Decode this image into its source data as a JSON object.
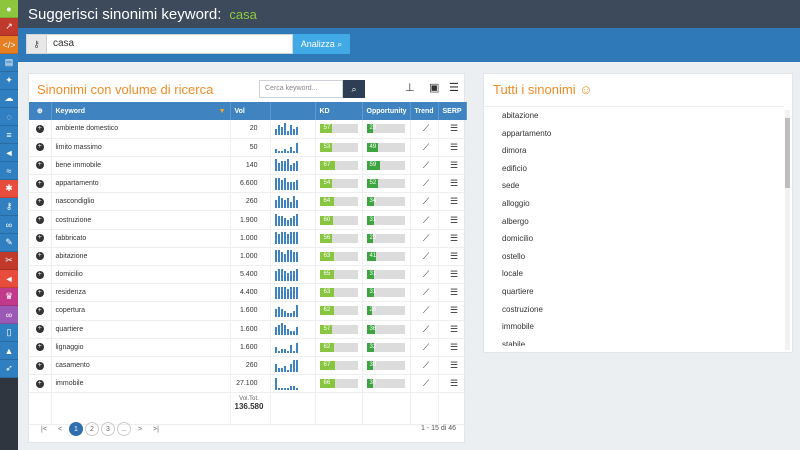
{
  "header": {
    "title": "Suggerisci sinonimi keyword:",
    "keyword": "casa"
  },
  "search": {
    "value": "casa",
    "button": "Analizza"
  },
  "sidebar": {
    "items": [
      {
        "icon": "globe-icon",
        "glyph": "●",
        "color": "#8cc63f"
      },
      {
        "icon": "chart-icon",
        "glyph": "↗",
        "color": "#c0392b"
      },
      {
        "icon": "code-icon",
        "glyph": "</>",
        "color": "#e67e22"
      },
      {
        "icon": "book-icon",
        "glyph": "▤",
        "color": "#2f7fc1"
      },
      {
        "icon": "running-icon",
        "glyph": "✦",
        "color": "#2f7fc1"
      },
      {
        "icon": "cloud-icon",
        "glyph": "☁",
        "color": "#2f7fc1"
      },
      {
        "icon": "chat-icon",
        "glyph": "◌",
        "color": "#2f7fc1"
      },
      {
        "icon": "signpost-icon",
        "glyph": "≡",
        "color": "#2f7fc1"
      },
      {
        "icon": "megaphone-icon",
        "glyph": "◄",
        "color": "#2f7fc1"
      },
      {
        "icon": "swimmer-icon",
        "glyph": "≈",
        "color": "#2f7fc1"
      },
      {
        "icon": "bug-icon",
        "glyph": "✱",
        "color": "#e74c3c"
      },
      {
        "icon": "key-icon",
        "glyph": "⚷",
        "color": "#2f7fc1"
      },
      {
        "icon": "link-icon",
        "glyph": "∞",
        "color": "#2f7fc1"
      },
      {
        "icon": "edit-icon",
        "glyph": "✎",
        "color": "#2f7fc1"
      },
      {
        "icon": "tools-icon",
        "glyph": "✂",
        "color": "#c0392b"
      },
      {
        "icon": "bullhorn-icon",
        "glyph": "◄",
        "color": "#e74c3c"
      },
      {
        "icon": "trophy-icon",
        "glyph": "♛",
        "color": "#c0398a"
      },
      {
        "icon": "binoculars-icon",
        "glyph": "∞",
        "color": "#9b59b6"
      },
      {
        "icon": "file-icon",
        "glyph": "▯",
        "color": "#2f7fc1"
      },
      {
        "icon": "graduation-icon",
        "glyph": "▲",
        "color": "#2f7fc1"
      },
      {
        "icon": "rocket-icon",
        "glyph": "➶",
        "color": "#2f7fc1"
      }
    ]
  },
  "panel": {
    "title": "Sinonimi con volume di ricerca",
    "filter_placeholder": "Cerca keyword...",
    "columns": [
      "Keyword",
      "Vol",
      "KD",
      "Opportunity",
      "Trend",
      "SERP"
    ],
    "rows": [
      {
        "keyword": "ambiente domestico",
        "vol": "20",
        "kd": 57,
        "opp": 28,
        "spark": [
          3,
          5,
          4,
          6,
          2,
          5,
          3,
          4
        ]
      },
      {
        "keyword": "limito massimo",
        "vol": "50",
        "kd": 53,
        "opp": 49,
        "spark": [
          2,
          1,
          1,
          2,
          1,
          3,
          1,
          5
        ]
      },
      {
        "keyword": "bene immobile",
        "vol": "140",
        "kd": 67,
        "opp": 59,
        "spark": [
          6,
          4,
          5,
          5,
          6,
          3,
          4,
          5
        ]
      },
      {
        "keyword": "appartamento",
        "vol": "6.600",
        "kd": 54,
        "opp": 52,
        "spark": [
          6,
          6,
          5,
          6,
          4,
          4,
          4,
          5
        ]
      },
      {
        "keyword": "nascondiglio",
        "vol": "260",
        "kd": 64,
        "opp": 34,
        "spark": [
          4,
          6,
          5,
          4,
          5,
          3,
          6,
          4
        ]
      },
      {
        "keyword": "costruzione",
        "vol": "1.900",
        "kd": 60,
        "opp": 31,
        "spark": [
          6,
          5,
          5,
          4,
          3,
          4,
          5,
          6
        ]
      },
      {
        "keyword": "fabbricato",
        "vol": "1.000",
        "kd": 56,
        "opp": 29,
        "spark": [
          6,
          5,
          6,
          6,
          5,
          6,
          6,
          6
        ]
      },
      {
        "keyword": "abitazione",
        "vol": "1.000",
        "kd": 63,
        "opp": 41,
        "spark": [
          6,
          6,
          5,
          4,
          6,
          6,
          5,
          5
        ]
      },
      {
        "keyword": "domicilio",
        "vol": "5.400",
        "kd": 65,
        "opp": 31,
        "spark": [
          5,
          6,
          6,
          5,
          4,
          5,
          5,
          6
        ]
      },
      {
        "keyword": "residenza",
        "vol": "4.400",
        "kd": 63,
        "opp": 31,
        "spark": [
          6,
          6,
          6,
          6,
          5,
          6,
          6,
          6
        ]
      },
      {
        "keyword": "copertura",
        "vol": "1.600",
        "kd": 62,
        "opp": 26,
        "spark": [
          4,
          5,
          4,
          3,
          2,
          2,
          3,
          6
        ]
      },
      {
        "keyword": "quartiere",
        "vol": "1.600",
        "kd": 57,
        "opp": 36,
        "spark": [
          4,
          5,
          6,
          5,
          3,
          2,
          2,
          4
        ]
      },
      {
        "keyword": "lignaggio",
        "vol": "1.600",
        "kd": 62,
        "opp": 32,
        "spark": [
          3,
          1,
          2,
          2,
          1,
          4,
          1,
          5
        ]
      },
      {
        "keyword": "casamento",
        "vol": "260",
        "kd": 67,
        "opp": 30,
        "spark": [
          4,
          2,
          2,
          3,
          1,
          4,
          6,
          6
        ]
      },
      {
        "keyword": "immobile",
        "vol": "27.100",
        "kd": 66,
        "opp": 30,
        "spark": [
          6,
          1,
          1,
          1,
          1,
          2,
          2,
          1
        ]
      }
    ],
    "total_label": "Vol.Tot.",
    "total_value": "136.580",
    "pager": {
      "first": "|<",
      "prev": "<",
      "pages": [
        "1",
        "2",
        "3",
        "..."
      ],
      "next": ">",
      "last": ">|",
      "range": "1 - 15 di 46"
    }
  },
  "synonyms": {
    "title": "Tutti i sinonimi ☺",
    "items": [
      "abitazione",
      "appartamento",
      "dimora",
      "edificio",
      "sede",
      "alloggio",
      "albergo",
      "domicilio",
      "ostello",
      "locale",
      "quartiere",
      "costruzione",
      "immobile",
      "stabile"
    ]
  }
}
